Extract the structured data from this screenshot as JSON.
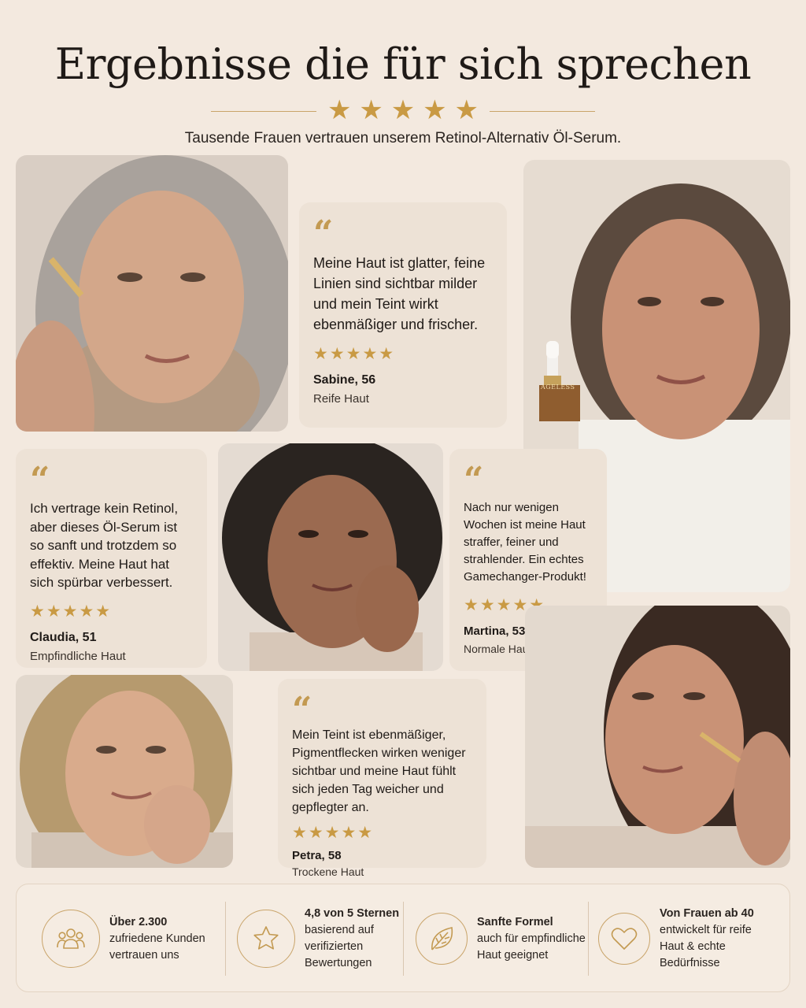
{
  "header": {
    "title": "Ergebnisse die für sich sprechen",
    "stars": [
      "★",
      "★",
      "★",
      "★",
      "★"
    ],
    "subtitle": "Tausende Frauen vertrauen unserem Retinol-Alternativ Öl-Serum."
  },
  "product": {
    "label": "AGELESS"
  },
  "reviews": [
    {
      "quote_mark": "“",
      "text": "Meine Haut ist glatter, feine Linien sind sichtbar milder und mein Teint wirkt ebenmäßiger und frischer.",
      "stars": "★★★★★",
      "name": "Sabine, 56",
      "skin": "Reife Haut"
    },
    {
      "quote_mark": "“",
      "text": "Ich vertrage kein Retinol, aber dieses Öl-Serum ist so sanft und trotzdem so effektiv. Meine Haut hat sich spürbar verbessert.",
      "stars": "★★★★★",
      "name": "Claudia, 51",
      "skin": "Empfindliche Haut"
    },
    {
      "quote_mark": "“",
      "text": "Nach nur wenigen Wochen ist meine Haut straffer, feiner und strahlender. Ein echtes Gamechanger-Produkt!",
      "stars": "★★★★★",
      "name": "Martina, 53",
      "skin": "Normale Haut"
    },
    {
      "quote_mark": "“",
      "text": "Mein Teint ist ebenmäßiger, Pigmentflecken wirken weniger sichtbar und meine Haut fühlt sich jeden Tag weicher und gepflegter an.",
      "stars": "★★★★★",
      "name": "Petra, 58",
      "skin": "Trockene Haut"
    }
  ],
  "features": [
    {
      "icon": "people-icon",
      "title": "Über 2.300",
      "text": "zufriedene Kunden vertrauen uns"
    },
    {
      "icon": "star-icon",
      "title": "4,8 von 5 Sternen",
      "text": "basierend auf verifizierten Bewertungen"
    },
    {
      "icon": "leaf-icon",
      "title": "Sanfte Formel",
      "text": "auch für empfindliche Haut geeignet"
    },
    {
      "icon": "heart-icon",
      "title": "Von Frauen ab 40",
      "text": "entwickelt für reife Haut & echte Bedürfnisse"
    }
  ],
  "colors": {
    "background": "#f3e9df",
    "card": "#ede2d6",
    "gold": "#c99a44",
    "text": "#1f1a17"
  }
}
